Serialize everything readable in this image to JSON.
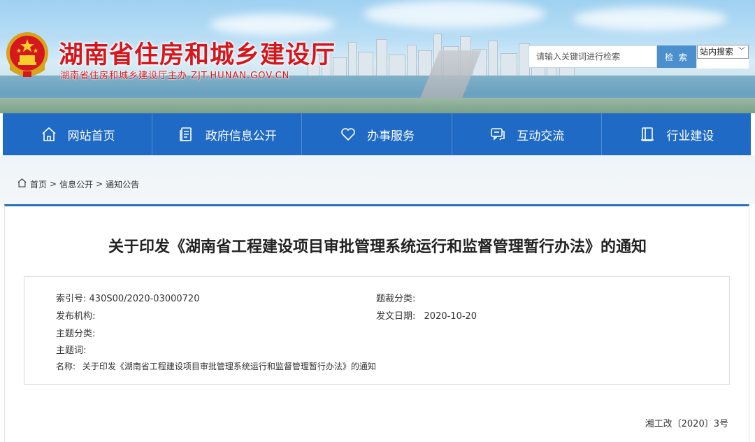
{
  "header": {
    "site_title": "湖南省住房和城乡建设厅",
    "site_subtitle": "湖南省住房和城乡建设厅主办 ZJT.HUNAN.GOV.CN",
    "search": {
      "placeholder": "请输入关键词进行检索",
      "button_label": "检 索",
      "scope_selected": "站内搜索"
    }
  },
  "nav": {
    "items": [
      {
        "label": "网站首页",
        "icon": "home-icon"
      },
      {
        "label": "政府信息公开",
        "icon": "document-list-icon"
      },
      {
        "label": "办事服务",
        "icon": "heart-icon"
      },
      {
        "label": "互动交流",
        "icon": "chat-icon"
      },
      {
        "label": "行业建设",
        "icon": "book-icon"
      }
    ]
  },
  "breadcrumb": {
    "items": [
      "首页",
      "信息公开",
      "通知公告"
    ],
    "separator": ">"
  },
  "article": {
    "title": "关于印发《湖南省工程建设项目审批管理系统运行和监督管理暂行办法》的通知",
    "meta": {
      "index_label": "索引号:",
      "index_value": "430S00/2020-03000720",
      "category_label": "题裁分类:",
      "category_value": "",
      "publisher_label": "发布机构:",
      "publisher_value": "",
      "date_label": "发文日期:",
      "date_value": "2020-10-20",
      "topic_label": "主题分类:",
      "topic_value": "",
      "keywords_label": "主题词:",
      "keywords_value": "",
      "name_label": "名称:",
      "name_value": "关于印发《湖南省工程建设项目审批管理系统运行和监督管理暂行办法》的通知"
    },
    "doc_number": "湘工改〔2020〕3号"
  },
  "colors": {
    "brand_red": "#d5161c",
    "nav_blue": "#1f6ac4",
    "search_button": "#4c8fcd"
  }
}
